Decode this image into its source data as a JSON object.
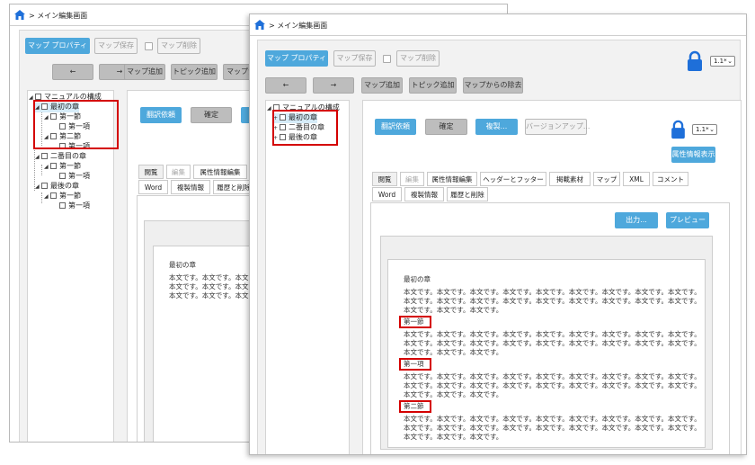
{
  "window_title": "> メイン編集画面",
  "toolbar": {
    "map_properties": "マップ プロパティ",
    "map_save": "マップ保存",
    "map_delete": "マップ削除",
    "back": "←",
    "forward": "→",
    "map_add": "マップ追加",
    "topic_add": "トピック追加",
    "map_remove_partial": "マップか",
    "map_remove": "マップからの除去"
  },
  "version_select": "1.1*",
  "tree_a": {
    "root": "マニュアルの構成",
    "ch1": "最初の章",
    "sec1": "第一節",
    "item1": "第一項",
    "sec2": "第二節",
    "item2": "第一項",
    "ch2": "二番目の章",
    "ch2_sec1": "第一節",
    "ch2_item1": "第一項",
    "ch3": "最後の章",
    "ch3_sec1": "第一節",
    "ch3_item1": "第一項"
  },
  "tree_b": {
    "root": "マニュアルの構成",
    "ch1": "最初の章",
    "ch2": "二番目の章",
    "ch3": "最後の章"
  },
  "content_buttons": {
    "translate": "翻訳依頼",
    "confirm": "確定",
    "copy": "複製...",
    "version_up": "バージョンアップ...",
    "attr_display": "属性情報表示",
    "output": "出力...",
    "preview": "プレビュー"
  },
  "tabs_row1": [
    "閲覧",
    "編集",
    "属性情報編集",
    "ヘッダーとフッター",
    "掲載素材",
    "マップ",
    "XML",
    "コメント"
  ],
  "tabs_row2": [
    "Word",
    "複製情報",
    "履歴と削除"
  ],
  "doc_a": {
    "title": "最初の章",
    "lines": [
      "本文です。本文です。本文です",
      "本文です。本文です。本文です",
      "本文です。本文です。本文です"
    ]
  },
  "doc_b": {
    "title": "最初の章",
    "body_line": "本文です。本文です。本文です。本文です。本文です。本文です。本文です。本文です。本文です。",
    "body_short": "本文です。本文です。本文です。",
    "heading_sec1": "第一節",
    "heading_item1": "第一項",
    "heading_sec2": "第二節"
  },
  "colors": {
    "accent_blue": "#4ea8dc",
    "lock_blue": "#1e6fd9",
    "highlight_red": "#d40000"
  }
}
